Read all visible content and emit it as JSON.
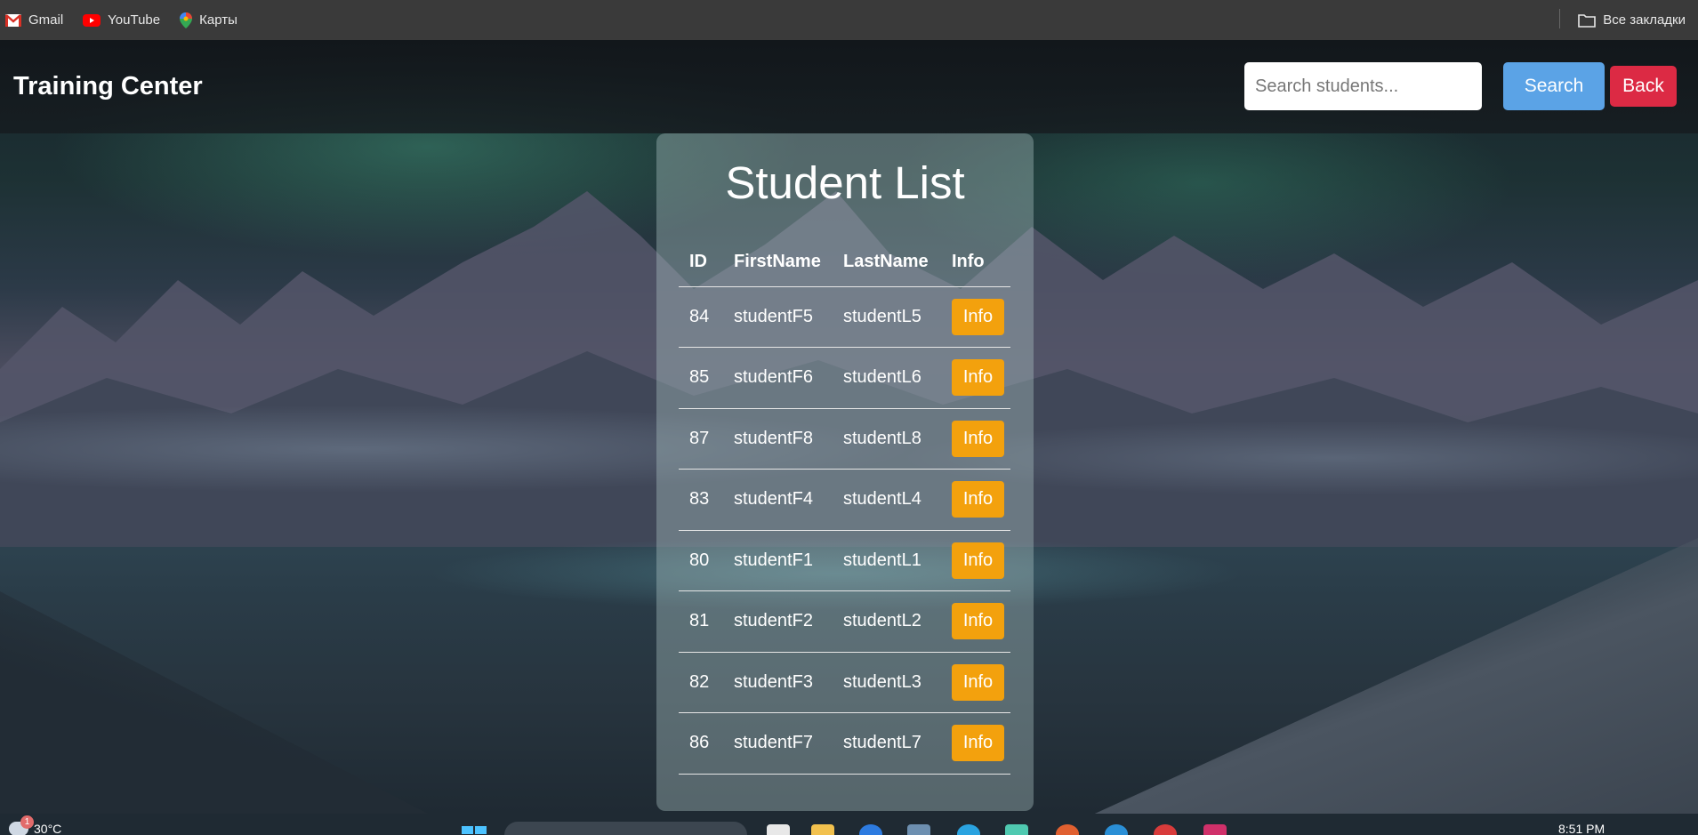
{
  "bookmarks": {
    "items": [
      {
        "label": "Gmail",
        "icon": "gmail-icon"
      },
      {
        "label": "YouTube",
        "icon": "youtube-icon"
      },
      {
        "label": "Карты",
        "icon": "maps-icon"
      }
    ],
    "all_bookmarks": "Все закладки"
  },
  "header": {
    "brand": "Training Center",
    "search_placeholder": "Search students...",
    "search_label": "Search",
    "back_label": "Back"
  },
  "card": {
    "title": "Student List",
    "columns": [
      "ID",
      "FirstName",
      "LastName",
      "Info"
    ],
    "rows": [
      {
        "id": "84",
        "first": "studentF5",
        "last": "studentL5",
        "info": "Info"
      },
      {
        "id": "85",
        "first": "studentF6",
        "last": "studentL6",
        "info": "Info"
      },
      {
        "id": "87",
        "first": "studentF8",
        "last": "studentL8",
        "info": "Info"
      },
      {
        "id": "83",
        "first": "studentF4",
        "last": "studentL4",
        "info": "Info"
      },
      {
        "id": "80",
        "first": "studentF1",
        "last": "studentL1",
        "info": "Info"
      },
      {
        "id": "81",
        "first": "studentF2",
        "last": "studentL2",
        "info": "Info"
      },
      {
        "id": "82",
        "first": "studentF3",
        "last": "studentL3",
        "info": "Info"
      },
      {
        "id": "86",
        "first": "studentF7",
        "last": "studentL7",
        "info": "Info"
      }
    ]
  },
  "taskbar": {
    "weather_temp": "30°C",
    "weather_badge": "1",
    "time": "8:51 PM"
  },
  "colors": {
    "search_button": "#5ba3e6",
    "back_button": "#dc2a44",
    "info_button": "#f3a10d"
  }
}
